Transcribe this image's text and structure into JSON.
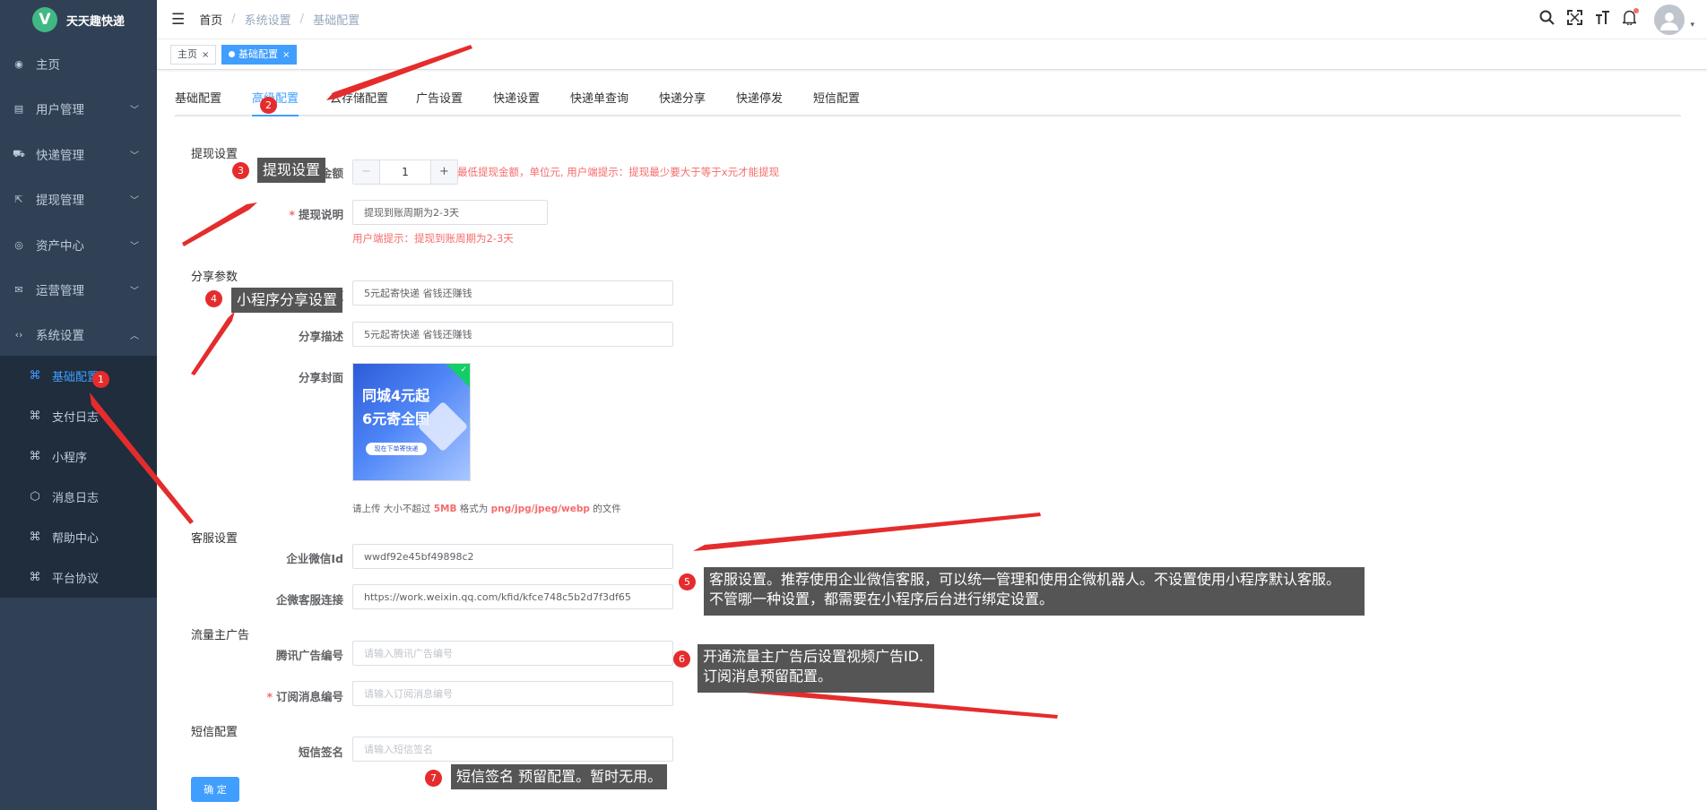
{
  "app": {
    "logo_letter": "V",
    "name": "天天趣快递"
  },
  "sidebar": {
    "items": [
      {
        "label": "主页",
        "icon": "dashboard-icon",
        "glyph": "◉"
      },
      {
        "label": "用户管理",
        "icon": "user-icon",
        "glyph": "▤"
      },
      {
        "label": "快递管理",
        "icon": "truck-icon",
        "glyph": "⛟"
      },
      {
        "label": "提现管理",
        "icon": "withdraw-icon",
        "glyph": "⇱"
      },
      {
        "label": "资产中心",
        "icon": "asset-icon",
        "glyph": "◎"
      },
      {
        "label": "运营管理",
        "icon": "mail-icon",
        "glyph": "✉"
      },
      {
        "label": "系统设置",
        "icon": "code-icon",
        "glyph": "‹›"
      }
    ],
    "subitems": [
      {
        "label": "基础配置",
        "icon": "grid-icon",
        "active": true
      },
      {
        "label": "支付日志",
        "icon": "grid-icon"
      },
      {
        "label": "小程序",
        "icon": "grid-icon"
      },
      {
        "label": "消息日志",
        "icon": "cube-icon"
      },
      {
        "label": "帮助中心",
        "icon": "grid-icon"
      },
      {
        "label": "平台协议",
        "icon": "grid-icon"
      }
    ]
  },
  "breadcrumb": {
    "home": "首页",
    "level2": "系统设置",
    "level3": "基础配置"
  },
  "tags": {
    "home": "主页",
    "current": "基础配置",
    "close": "×"
  },
  "tabs": [
    "基础配置",
    "高级配置",
    "云存储配置",
    "广告设置",
    "快递设置",
    "快递单查询",
    "快递分享",
    "快递停发",
    "短信配置"
  ],
  "form": {
    "withdraw": {
      "section": "提现设置",
      "min_label": "最低提现金额",
      "min_value": "1",
      "min_hint": "最低提现金额，单位元, 用户端提示：提现最少要大于等于x元才能提现",
      "desc_label": "提现说明",
      "desc_value": "提现到账周期为2-3天",
      "desc_hint": "用户端提示：提现到账周期为2-3天"
    },
    "share": {
      "section": "分享参数",
      "title_label": "分享标题",
      "title_value": "5元起寄快递 省钱还赚钱",
      "desc_label": "分享描述",
      "desc_value": "5元起寄快递 省钱还赚钱",
      "cover_label": "分享封面",
      "cover_line1": "同城4元起",
      "cover_line2": "6元寄全国",
      "cover_button": "现在下单寄快递",
      "upload_prefix": "请上传 大小不超过 ",
      "upload_size": "5MB",
      "upload_mid": " 格式为 ",
      "upload_formats": "png/jpg/jpeg/webp",
      "upload_suffix": " 的文件"
    },
    "service": {
      "section": "客服设置",
      "wechat_id_label": "企业微信Id",
      "wechat_id_value": "wwdf92e45bf49898c2",
      "wechat_link_label": "企微客服连接",
      "wechat_link_value": "https://work.weixin.qq.com/kfid/kfce748c5b2d7f3df65"
    },
    "ads": {
      "section": "流量主广告",
      "tencent_label": "腾讯广告编号",
      "tencent_placeholder": "请输入腾讯广告编号",
      "sub_label": "订阅消息编号",
      "sub_placeholder": "请输入订阅消息编号"
    },
    "sms": {
      "section": "短信配置",
      "sign_label": "短信签名",
      "sign_placeholder": "请输入短信签名"
    },
    "confirm": "确 定"
  },
  "annotations": [
    {
      "num": "1"
    },
    {
      "num": "2"
    },
    {
      "num": "3",
      "text": "提现设置"
    },
    {
      "num": "4",
      "text": "小程序分享设置"
    },
    {
      "num": "5",
      "line1": "客服设置。推荐使用企业微信客服，可以统一管理和使用企微机器人。不设置使用小程序默认客服。",
      "line2": "不管哪一种设置，都需要在小程序后台进行绑定设置。"
    },
    {
      "num": "6",
      "line1": "开通流量主广告后设置视频广告ID.",
      "line2": "订阅消息预留配置。"
    },
    {
      "num": "7",
      "text": "短信签名 预留配置。暂时无用。"
    }
  ],
  "colors": {
    "sidebar_bg": "#304156",
    "accent": "#409eff",
    "annotation_red": "#e52c2c"
  }
}
